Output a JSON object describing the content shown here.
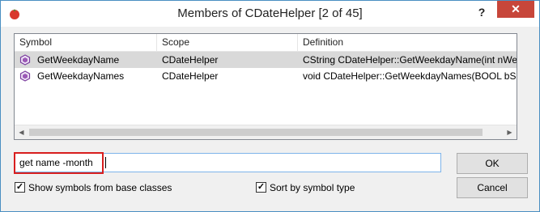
{
  "window": {
    "title": "Members of CDateHelper [2 of 45]",
    "help_label": "?",
    "close_label": "✕",
    "accent_color": "#c7463a"
  },
  "list": {
    "columns": [
      "Symbol",
      "Scope",
      "Definition"
    ],
    "rows": [
      {
        "symbol": "GetWeekdayName",
        "scope": "CDateHelper",
        "definition": "CString CDateHelper::GetWeekdayName(int nWeekd",
        "selected": true,
        "icon": "method-icon"
      },
      {
        "symbol": "GetWeekdayNames",
        "scope": "CDateHelper",
        "definition": "void CDateHelper::GetWeekdayNames(BOOL bShort,",
        "selected": false,
        "icon": "method-icon"
      }
    ]
  },
  "filter": {
    "value": "get name -month"
  },
  "options": {
    "show_base": {
      "label": "Show symbols from base classes",
      "checked": true
    },
    "sort_type": {
      "label": "Sort by symbol type",
      "checked": true
    }
  },
  "buttons": {
    "ok": "OK",
    "cancel": "Cancel"
  }
}
